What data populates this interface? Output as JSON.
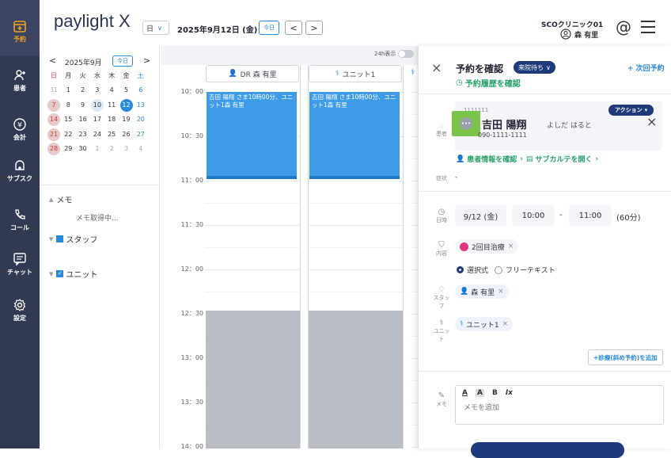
{
  "rail": {
    "items": [
      {
        "label": "予約",
        "icon": "calendar-plus-icon"
      },
      {
        "label": "患者",
        "icon": "person-add-icon"
      },
      {
        "label": "会計",
        "icon": "yen-circle-icon"
      },
      {
        "label": "サブスク",
        "icon": "subscription-icon"
      },
      {
        "label": "コール",
        "icon": "phone-icon"
      },
      {
        "label": "チャット",
        "icon": "chat-icon"
      },
      {
        "label": "設定",
        "icon": "gear-icon"
      }
    ],
    "active_color": "#f0a020",
    "bg_color": "#323a53"
  },
  "header": {
    "logo": "paylight X",
    "view_select": "日",
    "date": "2025年9月12日 (金)",
    "today_btn": "今日",
    "prev": "<",
    "next": ">",
    "clinic": "SCOクリニック01",
    "user": "森 有里"
  },
  "minical": {
    "month": "2025年9月",
    "today_btn": "今日",
    "prev": "<",
    "next": ">",
    "weekdays": [
      "日",
      "月",
      "火",
      "水",
      "木",
      "金",
      "土"
    ],
    "weeks": [
      [
        "31",
        "1",
        "2",
        "3",
        "4",
        "5",
        "6"
      ],
      [
        "7",
        "8",
        "9",
        "10",
        "11",
        "12",
        "13"
      ],
      [
        "14",
        "15",
        "16",
        "17",
        "18",
        "19",
        "20"
      ],
      [
        "21",
        "22",
        "23",
        "24",
        "25",
        "26",
        "27"
      ],
      [
        "28",
        "29",
        "30",
        "1",
        "2",
        "3",
        "4"
      ]
    ],
    "memo_label": "メモ",
    "memo_loading": "メモ取得中...",
    "staff_label": "スタッフ",
    "unit_label": "ユニット"
  },
  "schedule": {
    "toggle_label": "24h表示",
    "columns": [
      {
        "label": "DR 森 有里",
        "icon": "person-icon"
      },
      {
        "label": "ユニット1",
        "icon": "unit-icon"
      }
    ],
    "times": [
      "10：00",
      "10：30",
      "11：00",
      "11：30",
      "12：00",
      "12：30",
      "13：00",
      "13：30",
      "14：00"
    ],
    "appointments": [
      {
        "text": "吉田 陽翔 さま10時00分、ユニット1森 有里"
      },
      {
        "text": "吉田 陽翔 さま10時00分、ユニット1森 有里"
      }
    ],
    "appt_color": "#3e9be8"
  },
  "panel": {
    "close": "×",
    "title": "予約を確認",
    "status": "来院待ち",
    "next_booking": "+ 次回予約",
    "history_link": "予約履歴を確認",
    "patient_id": "1111111",
    "patient_name": "吉田 陽翔",
    "patient_kana": "よしだ はると",
    "patient_phone": "090-1111-1111",
    "action_btn": "アクション",
    "patient_label": "患者",
    "patient_info_link": "患者情報を確認",
    "subchart_link": "サブカルテを開く",
    "symptom_label": "症状",
    "symptom_value": "-",
    "datetime_label": "日時",
    "date": "9/12 (金)",
    "start": "10:00",
    "dash": "-",
    "end": "11:00",
    "duration": "(60分)",
    "content_label": "内容",
    "treatment_chip": "2回目治療",
    "radio_select": "選択式",
    "radio_free": "フリーテキスト",
    "staff_label": "スタッフ",
    "staff_chip": "森 有里",
    "unit_label": "ユニット",
    "unit_chip": "ユニット1",
    "add_treatment": "+診療(斜め予約)を追加",
    "memo_label": "メモ",
    "memo_placeholder": "メモを追加",
    "toolbar": [
      "A",
      "A",
      "B",
      "Ix"
    ],
    "accent_color": "#1f3a7a",
    "green_color": "#27a06b"
  }
}
